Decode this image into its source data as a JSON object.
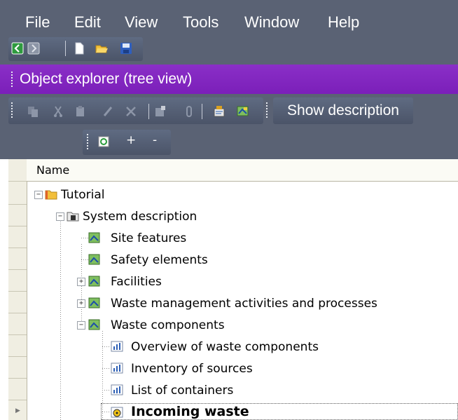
{
  "menu": {
    "items": [
      {
        "label": "File"
      },
      {
        "label": "Edit"
      },
      {
        "label": "View"
      },
      {
        "label": "Tools"
      },
      {
        "label": "Window"
      },
      {
        "label": "Help"
      }
    ]
  },
  "panel": {
    "title": "Object explorer (tree view)",
    "show_description_label": "Show description",
    "plus_label": "+",
    "minus_label": "-"
  },
  "grid": {
    "column_header": "Name"
  },
  "tree": {
    "nodes": [
      {
        "label": "Tutorial",
        "icon": "folder-icon",
        "expanded": true
      },
      {
        "label": "System description",
        "icon": "system-icon",
        "expanded": true
      },
      {
        "label": "Site features",
        "icon": "map-icon"
      },
      {
        "label": "Safety elements",
        "icon": "map-icon"
      },
      {
        "label": "Facilities",
        "icon": "map-icon",
        "expanded": false
      },
      {
        "label": "Waste management activities and processes",
        "icon": "map-icon",
        "expanded": false
      },
      {
        "label": "Waste components",
        "icon": "map-icon",
        "expanded": true
      },
      {
        "label": "Overview of waste components",
        "icon": "chart-icon"
      },
      {
        "label": "Inventory of sources",
        "icon": "chart-icon"
      },
      {
        "label": "List of containers",
        "icon": "chart-icon"
      },
      {
        "label": "Incoming waste",
        "icon": "radiation-icon",
        "selected": true
      }
    ]
  },
  "colors": {
    "menubar_bg": "#5a6274",
    "titlebar_bg": "#7b1fb9",
    "rowheader_bg": "#f0eee2"
  }
}
